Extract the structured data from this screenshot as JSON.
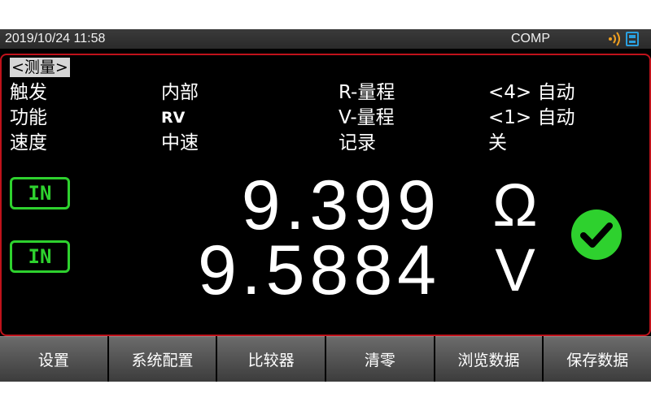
{
  "status_bar": {
    "datetime": "2019/10/24  11:58",
    "mode": "COMP",
    "icons": [
      "signal-icon",
      "storage-icon"
    ],
    "accent_color": "#f0a020",
    "storage_color": "#2aa0e0"
  },
  "page_tab": "<测量>",
  "params": {
    "trigger_label": "触发",
    "trigger_value": "内部",
    "function_label": "功能",
    "function_value": "RV",
    "speed_label": "速度",
    "speed_value": "中速",
    "r_range_label": "R-量程",
    "r_range_value": "<4> 自动",
    "v_range_label": "V-量程",
    "v_range_value": "<1> 自动",
    "record_label": "记录",
    "record_value": "关"
  },
  "readings": [
    {
      "badge": "IN",
      "value": "9.399",
      "unit": "Ω"
    },
    {
      "badge": "IN",
      "value": "9.5884",
      "unit": "V"
    }
  ],
  "result_icon": "check-circle-icon",
  "colors": {
    "pass": "#2ed12e",
    "border": "#c0121b"
  },
  "softkeys": [
    "设置",
    "系统配置",
    "比较器",
    "清零",
    "浏览数据",
    "保存数据"
  ]
}
